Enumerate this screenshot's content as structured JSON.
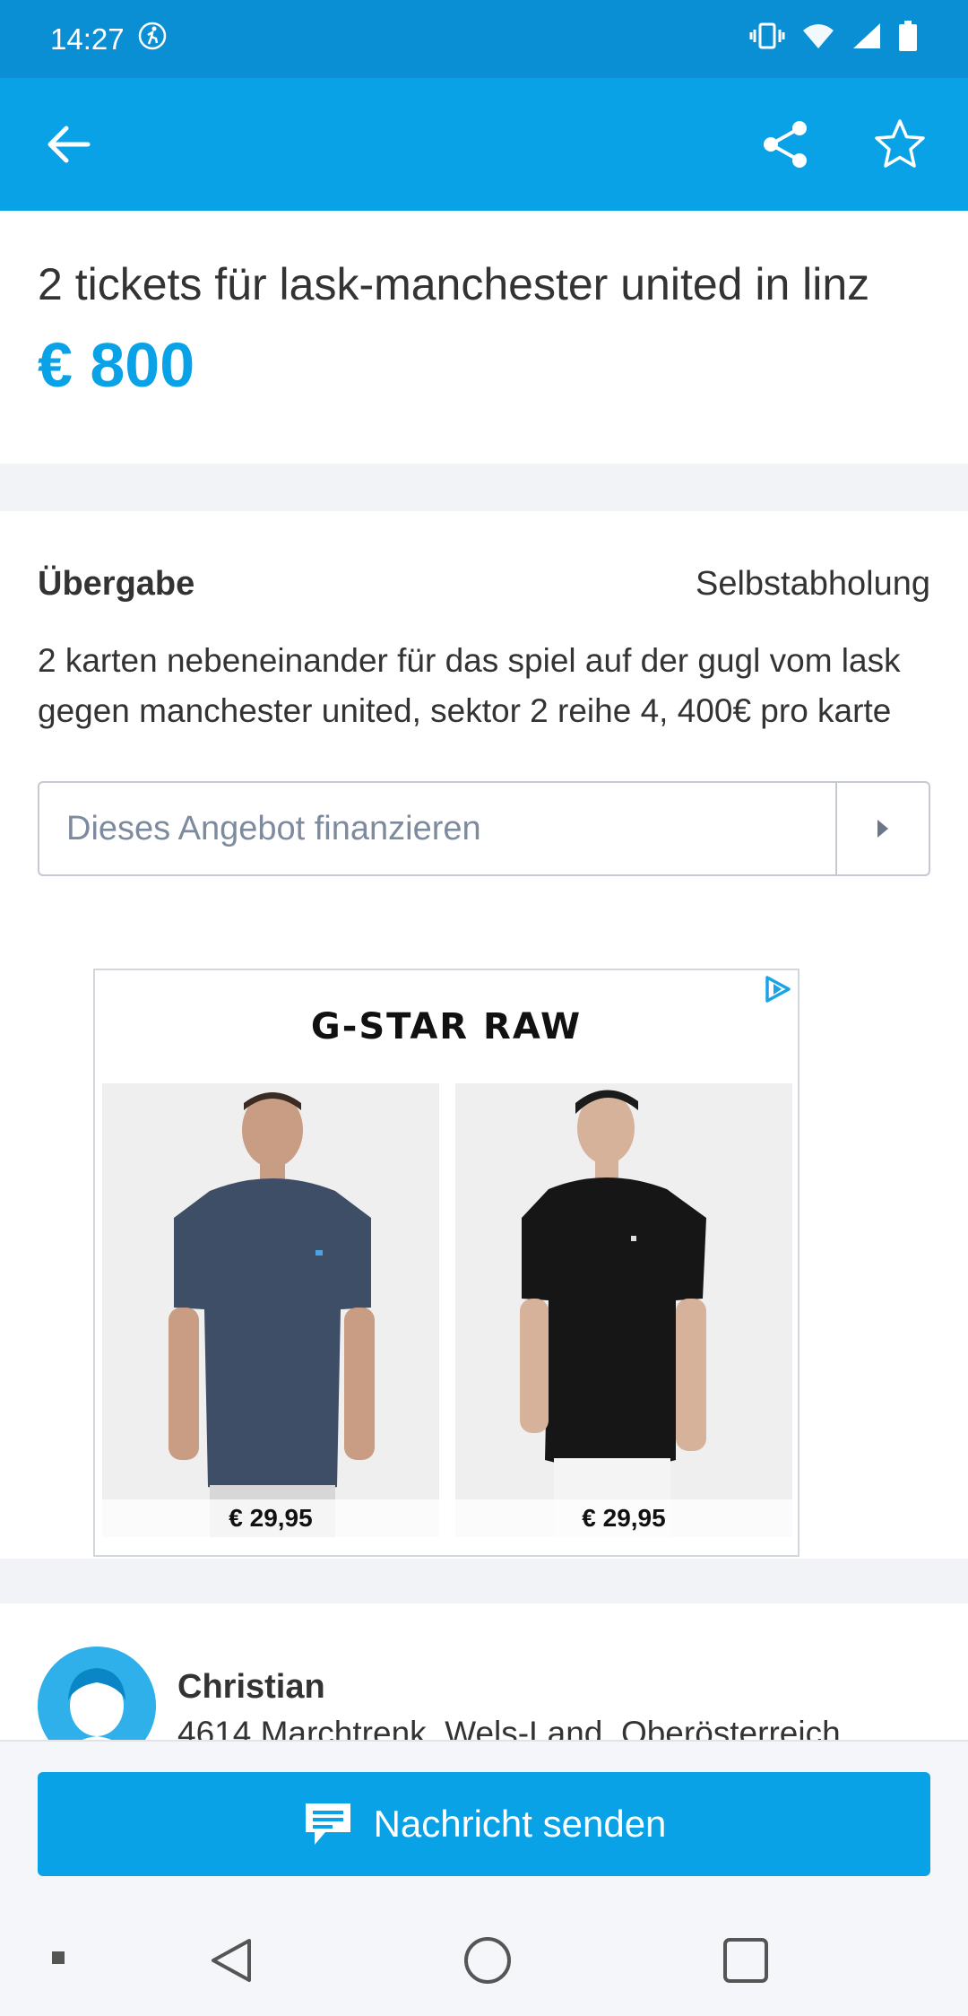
{
  "status_bar": {
    "time": "14:27"
  },
  "listing": {
    "title": "2 tickets für lask-manchester united in linz",
    "price": "€ 800",
    "handover_label": "Übergabe",
    "handover_value": "Selbstabholung",
    "description": "2 karten nebeneinander für das spiel auf der gugl vom lask gegen manchester united, sektor 2 reihe 4, 400€ pro karte",
    "finance_label": "Dieses Angebot finanzieren"
  },
  "ad": {
    "brand": "G-STAR RAW",
    "products": [
      {
        "price": "€ 29,95"
      },
      {
        "price": "€ 29,95"
      }
    ]
  },
  "seller": {
    "name": "Christian",
    "location": "4614 Marchtrenk, Wels-Land, Oberösterreich"
  },
  "actions": {
    "send_message": "Nachricht senden"
  },
  "colors": {
    "primary": "#0aa2e6",
    "status_bar": "#0a8fd4"
  }
}
